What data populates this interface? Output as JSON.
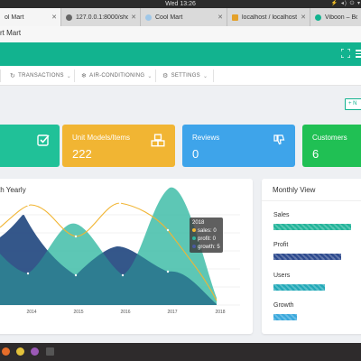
{
  "os": {
    "clock": "Wed 13:26",
    "tray": "⚡ ◂) ⏻ ▾"
  },
  "browser": {
    "tabs": [
      {
        "label": "ol Mart",
        "fav": "#2fb5a0",
        "active": true
      },
      {
        "label": "127.0.0.1:8000/show",
        "fav": "#666666",
        "active": false
      },
      {
        "label": "Cool Mart",
        "fav": "#9fc7e8",
        "active": false
      },
      {
        "label": "localhost / localhost",
        "fav": "#e4a12a",
        "active": false
      },
      {
        "label": "Viboon – Boo",
        "fav": "#12b38f",
        "active": false
      }
    ]
  },
  "app": {
    "title": "rt Mart"
  },
  "nav": {
    "items": [
      {
        "label": "TRANSACTIONS",
        "icon": "↻"
      },
      {
        "label": "AIR-CONDITIONING",
        "icon": "❄"
      },
      {
        "label": "SETTINGS",
        "icon": "⚙"
      }
    ]
  },
  "new_button": {
    "label": "+ N"
  },
  "cards": [
    {
      "title": "",
      "value": "",
      "color": "#20c198"
    },
    {
      "title": "Unit Models/Items",
      "value": "222",
      "color": "#f1b533"
    },
    {
      "title": "Reviews",
      "value": "0",
      "color": "#3ea4ea"
    },
    {
      "title": "Customers",
      "value": "6",
      "color": "#20c054"
    }
  ],
  "chart_panel": {
    "title": "th Yearly",
    "tooltip": {
      "year": "2018",
      "rows": [
        {
          "text": "sales: 0",
          "color": "#f1b533"
        },
        {
          "text": "profit: 0",
          "color": "#2fb59e"
        },
        {
          "text": "growth: 5",
          "color": "#4a5aa0"
        }
      ]
    }
  },
  "chart_data": {
    "type": "area",
    "x": [
      "2014",
      "2015",
      "2016",
      "2017",
      "2018"
    ],
    "series": [
      {
        "name": "sales",
        "color": "#f1b533",
        "values": [
          null,
          null,
          null,
          null,
          0
        ]
      },
      {
        "name": "profit",
        "color": "#2fb59e",
        "values": [
          null,
          null,
          null,
          null,
          0
        ]
      },
      {
        "name": "growth",
        "color": "#4a5aa0",
        "values": [
          null,
          null,
          null,
          null,
          5
        ]
      }
    ]
  },
  "monthly": {
    "title": "Monthly View",
    "rows": [
      {
        "label": "Sales",
        "fraction": 1.0,
        "color": "#23b49a"
      },
      {
        "label": "Profit",
        "fraction": 0.87,
        "color": "#2d4a8e"
      },
      {
        "label": "Users",
        "fraction": 0.66,
        "color": "#23a9b8"
      },
      {
        "label": "Growth",
        "fraction": 0.3,
        "color": "#3aa8dc"
      }
    ]
  },
  "dock": {
    "icons": [
      {
        "name": "firefox-icon",
        "color": "#e66d2a"
      },
      {
        "name": "chrome-icon",
        "color": "#e2c13b"
      },
      {
        "name": "app-icon",
        "color": "#9b59b6"
      },
      {
        "name": "terminal-icon",
        "color": "#555555"
      }
    ]
  }
}
